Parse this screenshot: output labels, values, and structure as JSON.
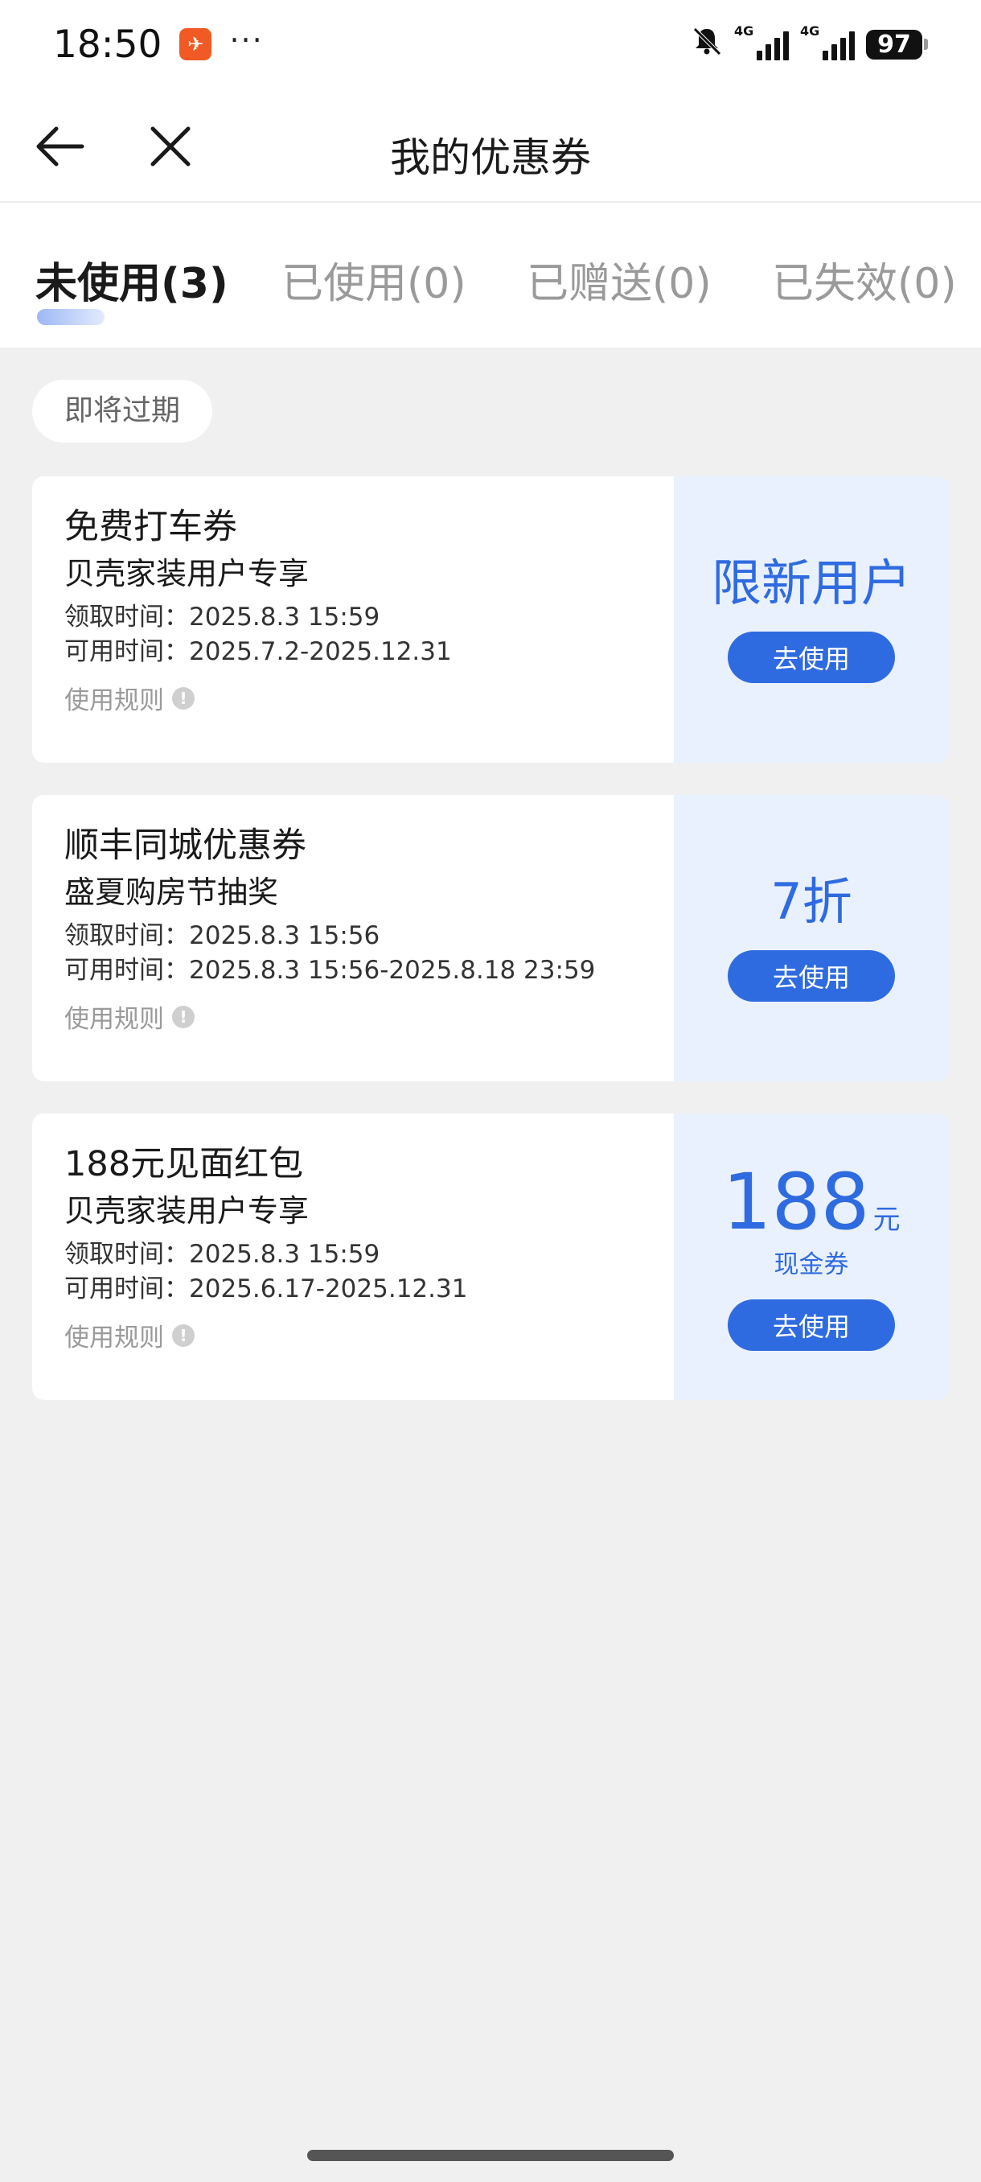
{
  "status_bar": {
    "time": "18:50",
    "app_icon": "feishu-icon",
    "dots": "···",
    "network_1": "4G",
    "network_2": "4G",
    "battery": "97"
  },
  "nav": {
    "title": "我的优惠券",
    "back_icon": "arrow-left-icon",
    "close_icon": "close-icon"
  },
  "tabs": [
    {
      "label": "未使用(3)",
      "active": true
    },
    {
      "label": "已使用(0)",
      "active": false
    },
    {
      "label": "已赠送(0)",
      "active": false
    },
    {
      "label": "已失效(0)",
      "active": false
    }
  ],
  "filter_chip": "即将过期",
  "coupons": [
    {
      "title": "免费打车券",
      "subtitle": "贝壳家装用户专享",
      "received": "领取时间：2025.8.3 15:59",
      "valid": "可用时间：2025.7.2-2025.12.31",
      "rule": "使用规则",
      "right_text": "限新用户",
      "button": "去使用"
    },
    {
      "title": "顺丰同城优惠券",
      "subtitle": "盛夏购房节抽奖",
      "received": "领取时间：2025.8.3 15:56",
      "valid": "可用时间：2025.8.3 15:56-2025.8.18 23:59",
      "rule": "使用规则",
      "right_text": "7折",
      "button": "去使用"
    },
    {
      "title": "188元见面红包",
      "subtitle": "贝壳家装用户专享",
      "received": "领取时间：2025.8.3 15:59",
      "valid": "可用时间：2025.6.17-2025.12.31",
      "rule": "使用规则",
      "amount": "188",
      "unit": "元",
      "amount_label": "现金券",
      "button": "去使用"
    }
  ],
  "colors": {
    "accent": "#2f6be0",
    "coupon_right_bg": "#eaf1fe",
    "page_bg": "#f0f0f0"
  }
}
